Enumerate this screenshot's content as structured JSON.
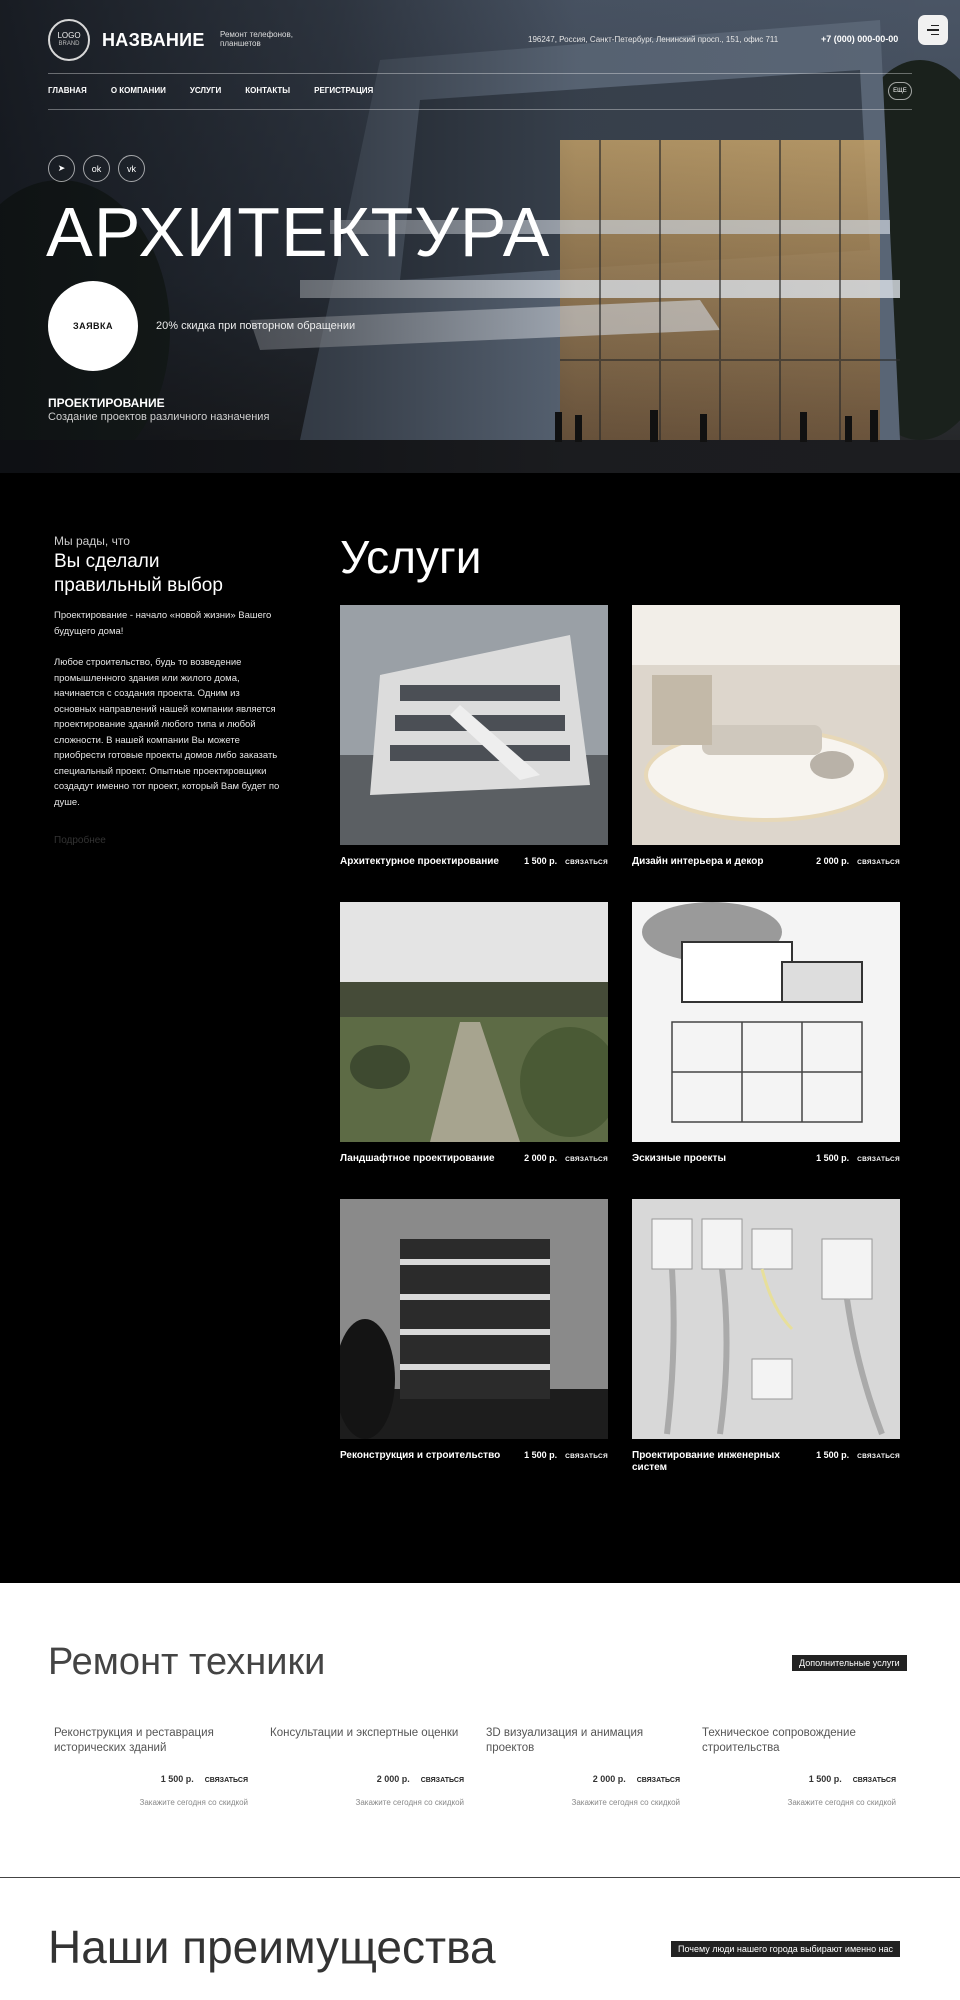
{
  "header": {
    "logo_text": "LOGO",
    "logo_sub": "BRAND",
    "brand_name": "НАЗВАНИЕ",
    "tagline": "Ремонт телефонов, планшетов",
    "address": "196247, Россия, Санкт-Петербург, Ленинский просп., 151, офис 711",
    "phone": "+7 (000) 000-00-00",
    "menu_icon": "menu-icon"
  },
  "nav": {
    "items": [
      "ГЛАВНАЯ",
      "О КОМПАНИИ",
      "УСЛУГИ",
      "КОНТАКТЫ",
      "РЕГИСТРАЦИЯ"
    ],
    "more": "ЕЩЕ"
  },
  "socials": [
    {
      "icon": "telegram-icon",
      "glyph": "➤"
    },
    {
      "icon": "odnoklassniki-icon",
      "glyph": "ok"
    },
    {
      "icon": "vk-icon",
      "glyph": "vk"
    }
  ],
  "hero": {
    "title": "АРХИТЕКТУРА",
    "button": "ЗАЯВКА",
    "discount": "20% скидка при повторном обращении",
    "subtitle": "ПРОЕКТИРОВАНИЕ",
    "subtitle_desc": "Создание проектов различного назначения"
  },
  "intro": {
    "small": "Мы рады, что",
    "big": "Вы сделали правильный выбор",
    "p1": "Проектирование - начало «новой жизни» Вашего будущего дома!",
    "p2": "Любое строительство, будь то возведение промышленного здания или жилого дома, начинается с создания проекта. Одним из основных направлений нашей компании является проектирование зданий любого типа и любой сложности. В нашей компании Вы можете приобрести готовые проекты домов либо заказать специальный проект. Опытные проектировщики создадут именно тот проект, который Вам будет по душе.",
    "link": "Подробнее"
  },
  "services": {
    "title": "Услуги",
    "cards": [
      {
        "name": "Архитектурное проектирование",
        "price": "1 500 р.",
        "contact": "СВЯЗАТЬСЯ"
      },
      {
        "name": "Дизайн интерьера и декор",
        "price": "2 000 р.",
        "contact": "СВЯЗАТЬСЯ"
      },
      {
        "name": "Ландшафтное проектирование",
        "price": "2 000 р.",
        "contact": "СВЯЗАТЬСЯ"
      },
      {
        "name": "Эскизные проекты",
        "price": "1 500 р.",
        "contact": "СВЯЗАТЬСЯ"
      },
      {
        "name": "Реконструкция и строительство",
        "price": "1 500 р.",
        "contact": "СВЯЗАТЬСЯ"
      },
      {
        "name": "Проектирование инженерных систем",
        "price": "1 500 р.",
        "contact": "СВЯЗАТЬСЯ"
      }
    ]
  },
  "repair": {
    "title": "Ремонт техники",
    "pill": "Дополнительные услуги",
    "items": [
      {
        "title": "Реконструкция и реставрация исторических зданий",
        "price": "1 500 р.",
        "contact": "СВЯЗАТЬСЯ",
        "note": "Закажите сегодня со скидкой"
      },
      {
        "title": "Консультации и экспертные оценки",
        "price": "2 000 р.",
        "contact": "СВЯЗАТЬСЯ",
        "note": "Закажите сегодня со скидкой"
      },
      {
        "title": "3D визуализация и анимация проектов",
        "price": "2 000 р.",
        "contact": "СВЯЗАТЬСЯ",
        "note": "Закажите сегодня со скидкой"
      },
      {
        "title": "Техническое сопровождение строительства",
        "price": "1 500 р.",
        "contact": "СВЯЗАТЬСЯ",
        "note": "Закажите сегодня со скидкой"
      }
    ]
  },
  "advantages": {
    "title": "Наши преимущества",
    "pill": "Почему люди нашего города выбирают именно нас"
  }
}
